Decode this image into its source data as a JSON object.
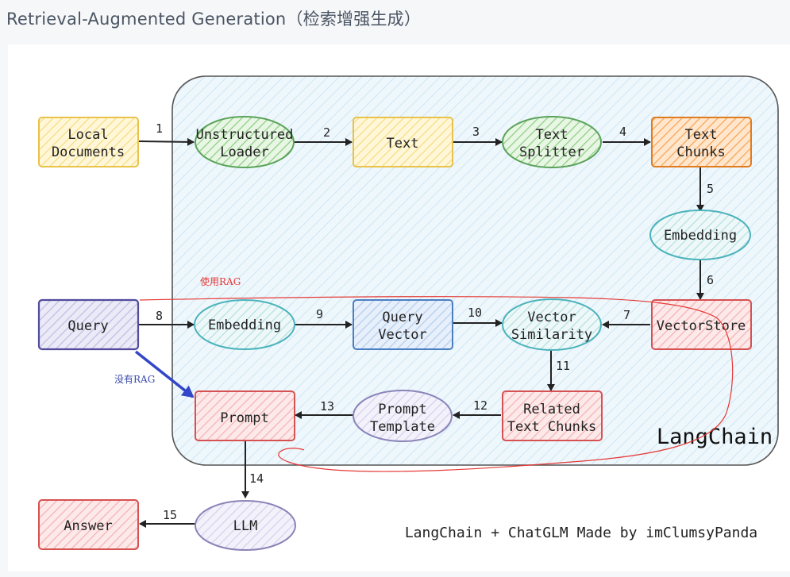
{
  "page": {
    "title": "Retrieval-Augmented Generation（检索增强生成）"
  },
  "diagram": {
    "container_label": "LangChain",
    "credit": "LangChain + ChatGLM Made by imClumsyPanda",
    "annotations": {
      "with_rag": "使用RAG",
      "without_rag": "没有RAG"
    },
    "nodes": {
      "local_documents": [
        "Local",
        "Documents"
      ],
      "unstructured_loader": [
        "Unstructured",
        "Loader"
      ],
      "text": [
        "Text"
      ],
      "text_splitter": [
        "Text",
        "Splitter"
      ],
      "text_chunks": [
        "Text",
        "Chunks"
      ],
      "embedding_top": [
        "Embedding"
      ],
      "vectorstore": [
        "VectorStore"
      ],
      "query": [
        "Query"
      ],
      "embedding_query": [
        "Embedding"
      ],
      "query_vector": [
        "Query",
        "Vector"
      ],
      "vector_similarity": [
        "Vector",
        "Similarity"
      ],
      "related_text_chunks": [
        "Related",
        "Text Chunks"
      ],
      "prompt_template": [
        "Prompt",
        "Template"
      ],
      "prompt": [
        "Prompt"
      ],
      "llm": [
        "LLM"
      ],
      "answer": [
        "Answer"
      ]
    },
    "steps": [
      "1",
      "2",
      "3",
      "4",
      "5",
      "6",
      "7",
      "8",
      "9",
      "10",
      "11",
      "12",
      "13",
      "14",
      "15"
    ],
    "colors": {
      "yellow_fill": "#fff3c8",
      "yellow_stroke": "#e8c24a",
      "green_fill": "#d7efd2",
      "green_stroke": "#5aa35a",
      "orange_fill": "#ffd8b0",
      "orange_stroke": "#e07b1f",
      "teal_fill": "#dff2f3",
      "teal_stroke": "#4bb3bb",
      "red_fill": "#fbd9d9",
      "red_stroke": "#d65151",
      "purple_fill": "#dedcf2",
      "purple_stroke": "#524b9d",
      "blue_fill": "#d8e6f7",
      "blue_stroke": "#4b7fc4",
      "lavender_fill": "#ebe8f6",
      "lavender_stroke": "#8a84b8",
      "container_fill": "#e6f3fb",
      "container_stroke": "#555555",
      "annotation_red": "#e53935",
      "annotation_blue": "#3346c8"
    }
  }
}
